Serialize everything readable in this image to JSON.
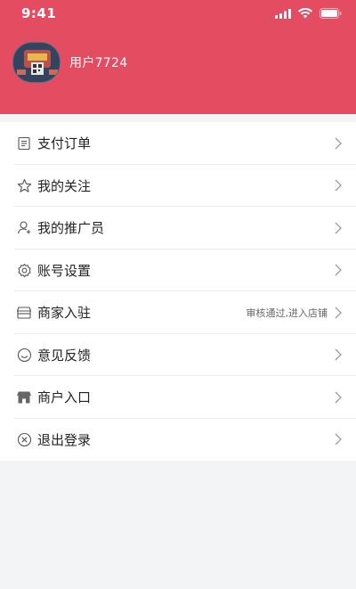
{
  "status_bar": {
    "time": "9:41"
  },
  "profile": {
    "username": "用户7724"
  },
  "menu": {
    "items": [
      {
        "label": "支付订单",
        "icon": "receipt-icon",
        "note": ""
      },
      {
        "label": "我的关注",
        "icon": "star-icon",
        "note": ""
      },
      {
        "label": "我的推广员",
        "icon": "user-plus-icon",
        "note": ""
      },
      {
        "label": "账号设置",
        "icon": "gear-icon",
        "note": ""
      },
      {
        "label": "商家入驻",
        "icon": "storefront-icon",
        "note": "审核通过,进入店铺"
      },
      {
        "label": "意见反馈",
        "icon": "smile-icon",
        "note": ""
      },
      {
        "label": "商户入口",
        "icon": "shop-awning-icon",
        "note": ""
      },
      {
        "label": "退出登录",
        "icon": "circle-x-icon",
        "note": ""
      }
    ]
  },
  "colors": {
    "header_bg": "#e44d61",
    "page_bg": "#f3f4f6"
  }
}
